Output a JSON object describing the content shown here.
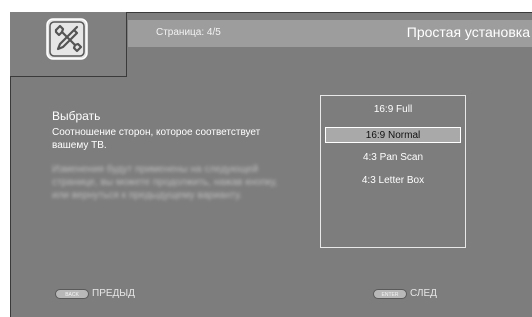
{
  "header": {
    "page_label": "Страница: 4/5",
    "title": "Простая установка"
  },
  "left": {
    "heading": "Выбрать",
    "description": "Соотношение сторон, которое соответствует вашему ТВ.",
    "blurred_text": "Изменения будут применены на следующей странице, вы можете продолжить, нажав кнопку, или вернуться к предыдущему варианту."
  },
  "options": [
    {
      "label": "16:9 Full",
      "selected": false
    },
    {
      "label": "16:9 Normal",
      "selected": true
    },
    {
      "label": "4:3 Pan Scan",
      "selected": false
    },
    {
      "label": "4:3 Letter Box",
      "selected": false
    }
  ],
  "footer": {
    "back_key": "BACK",
    "back_label": "ПРЕДЫД",
    "enter_key": "ENTER",
    "next_label": "СЛЕД"
  },
  "icons": [
    "settings-wrench-icon"
  ],
  "colors": {
    "background": "#7d7d7d",
    "header": "#9d9d9d",
    "highlight": "#a9a9a9"
  }
}
